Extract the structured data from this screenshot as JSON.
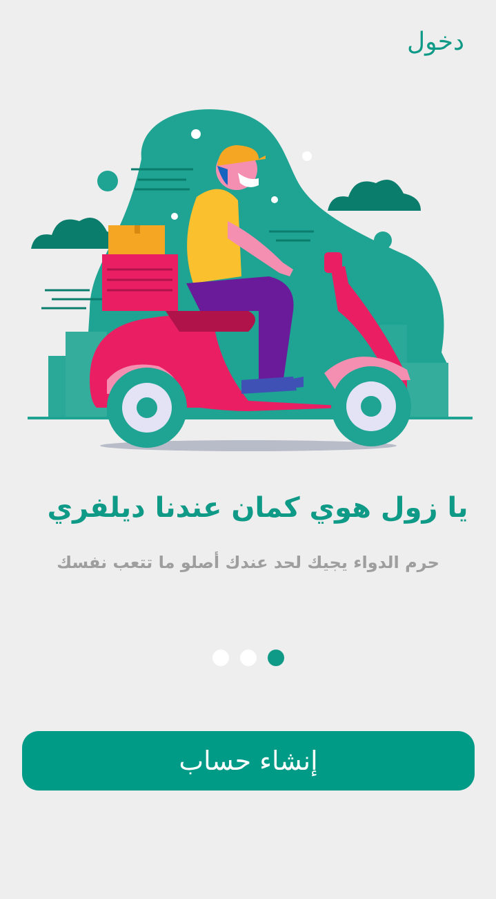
{
  "header": {
    "login_label": "دخول"
  },
  "illustration": {
    "icon": "delivery-scooter-illustration"
  },
  "onboarding": {
    "title": "يا زول هوي كمان عندنا ديلفري",
    "subtitle": "حرم الدواء يجيك لحد عندك أصلو ما تتعب نفسك",
    "page_count": 3,
    "active_page": 3
  },
  "actions": {
    "signup_label": "إنشاء حساب"
  },
  "colors": {
    "accent": "#0e9a86",
    "background": "#eeeeee",
    "subtitle": "#9e9e9e",
    "scooter": "#e91e63"
  }
}
